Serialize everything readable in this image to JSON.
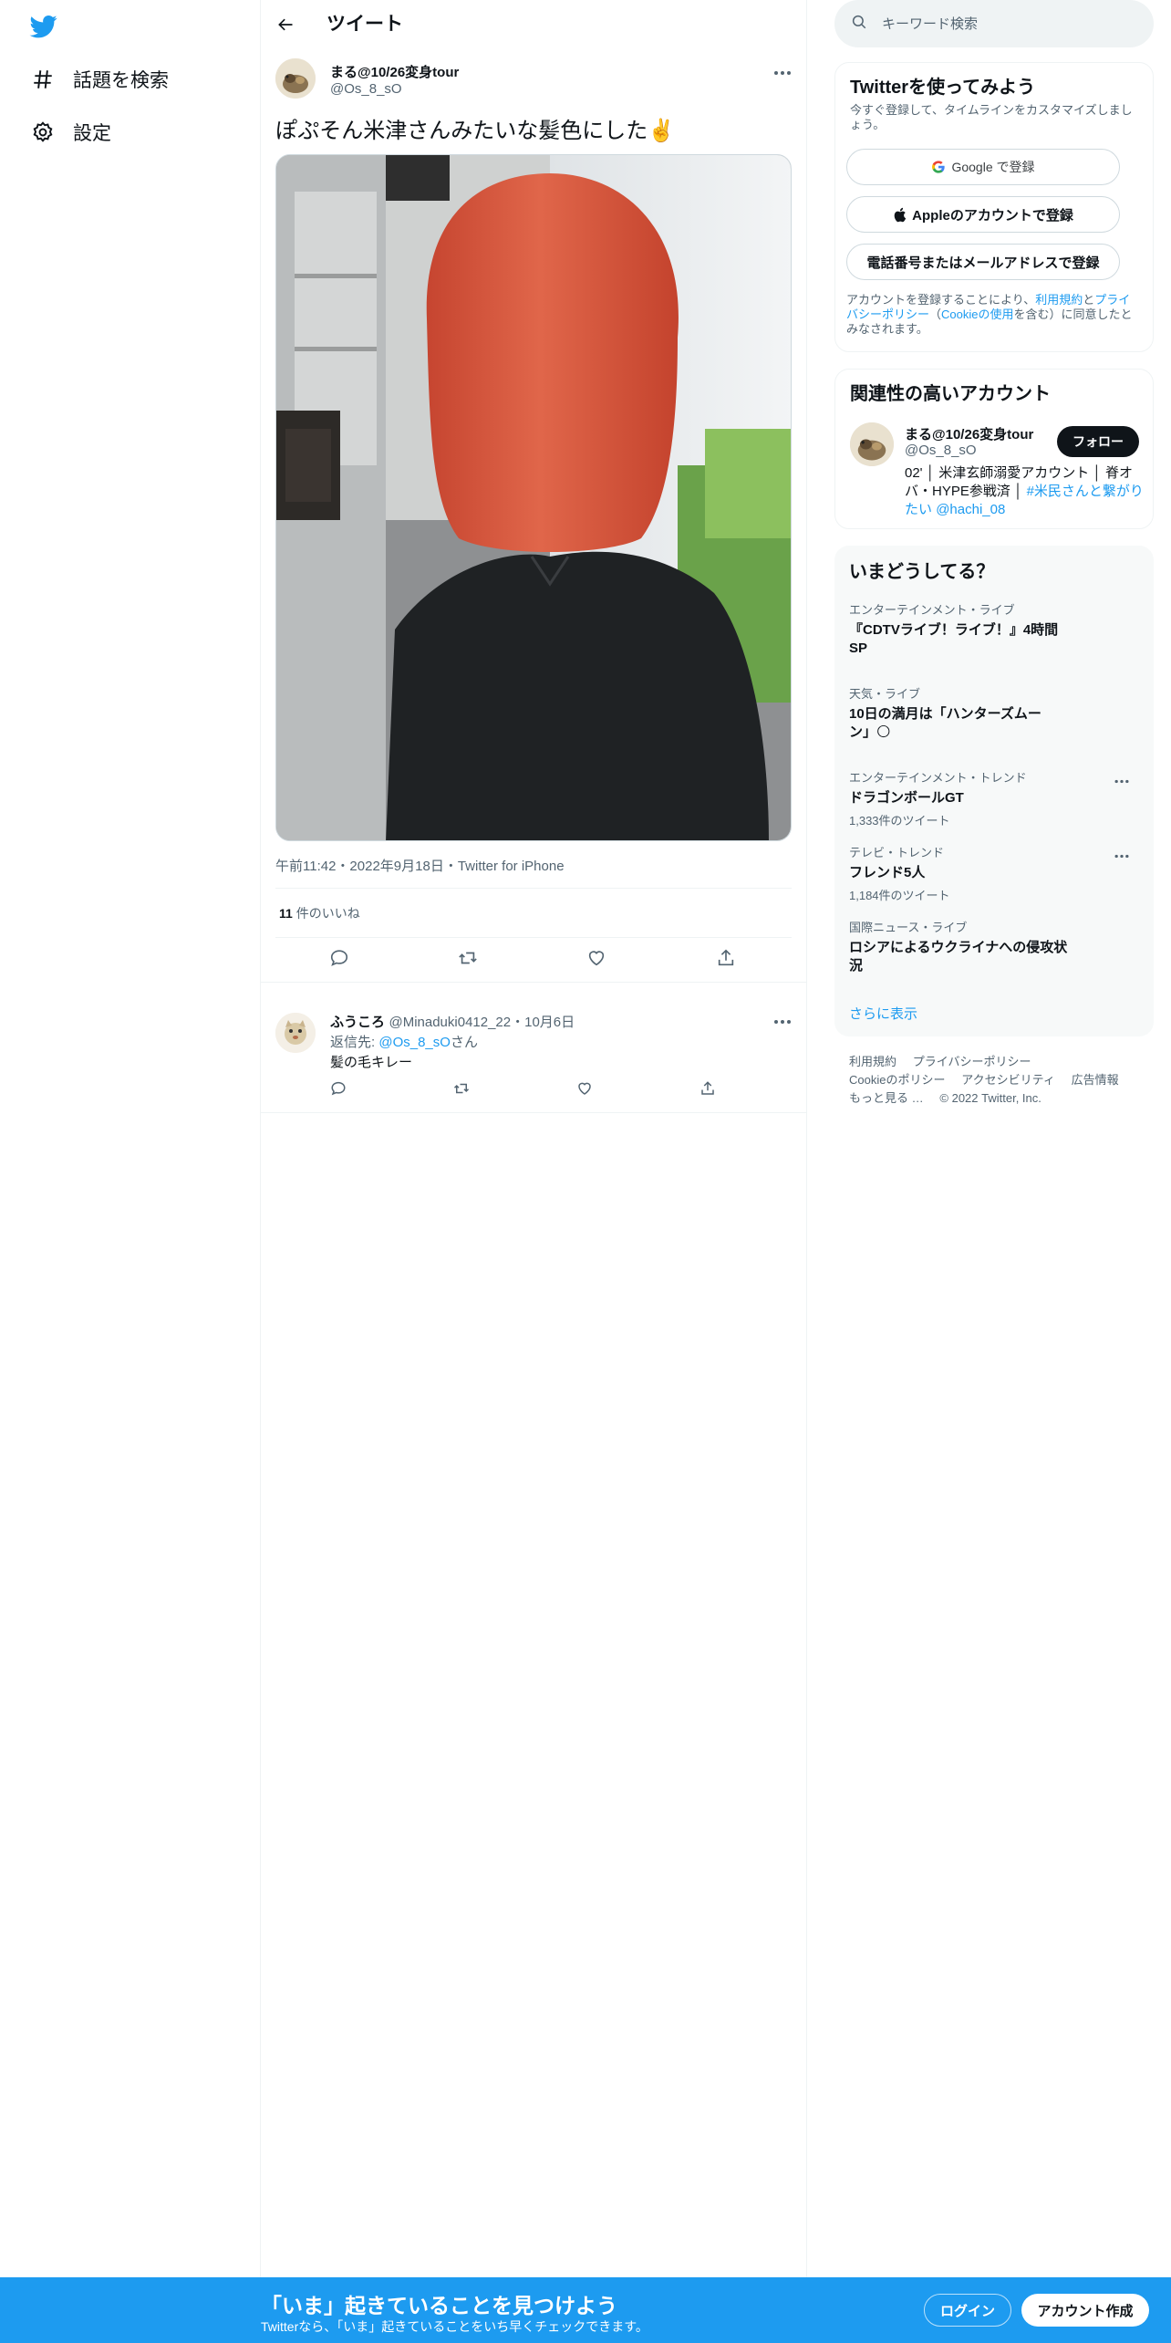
{
  "nav": {
    "items": [
      {
        "label": "話題を検索",
        "icon": "hashtag-icon"
      },
      {
        "label": "設定",
        "icon": "gear-icon"
      }
    ]
  },
  "header": {
    "title": "ツイート"
  },
  "tweet": {
    "author_name": "まる@10/26変身tour",
    "author_handle": "@Os_8_sO",
    "text": "ぽぷそん米津さんみたいな髪色にした✌️",
    "meta": "午前11:42・2022年9月18日・Twitter for iPhone",
    "likes_count": "11",
    "likes_label": " 件のいいね"
  },
  "reply": {
    "name": "ふうころ",
    "handle_date": "@Minaduki0412_22・10月6日",
    "reply_to_prefix": "返信先: ",
    "reply_to_handle": "@Os_8_sO",
    "reply_to_suffix": "さん",
    "text": "髪の毛キレー"
  },
  "search": {
    "placeholder": "キーワード検索"
  },
  "signup_card": {
    "title": "Twitterを使ってみよう",
    "subtitle": "今すぐ登録して、タイムラインをカスタマイズしましょう。",
    "google_button": "Google で登録",
    "apple_button": "Appleのアカウントで登録",
    "phone_button": "電話番号またはメールアドレスで登録",
    "legal_pre": "アカウントを登録することにより、",
    "legal_terms": "利用規約",
    "legal_and": "と",
    "legal_privacy": "プライバシーポリシー",
    "legal_paren_open": "（",
    "legal_cookie": "Cookieの使用",
    "legal_post": "を含む）に同意したとみなされます。"
  },
  "related": {
    "title": "関連性の高いアカウント",
    "name": "まる@10/26変身tour",
    "handle": "@Os_8_sO",
    "follow_label": "フォロー",
    "bio_text": "02' │ 米津玄師溺愛アカウント │ 脊オバ・HYPE参戦済 │ ",
    "bio_link1": "#米民さんと繋がりたい",
    "bio_space": " ",
    "bio_link2": "@hachi_08"
  },
  "trends": {
    "title": "いまどうしてる？",
    "items": [
      {
        "category": "エンターテインメント・ライブ",
        "title": "『CDTVライブ！ライブ！』4時間SP",
        "count": ""
      },
      {
        "category": "天気・ライブ",
        "title": "10日の満月は「ハンターズムーン」🌕",
        "count": ""
      },
      {
        "category": "エンターテインメント・トレンド",
        "title": "ドラゴンボールGT",
        "count": "1,333件のツイート"
      },
      {
        "category": "テレビ・トレンド",
        "title": "フレンド5人",
        "count": "1,184件のツイート"
      },
      {
        "category": "国際ニュース・ライブ",
        "title": "ロシアによるウクライナへの侵攻状況",
        "count": ""
      }
    ],
    "show_more": "さらに表示"
  },
  "footer": {
    "terms": "利用規約",
    "privacy": "プライバシーポリシー",
    "cookie": "Cookieのポリシー",
    "accessibility": "アクセシビリティ",
    "ads": "広告情報",
    "more": "もっと見る …",
    "copyright": "© 2022 Twitter, Inc."
  },
  "banner": {
    "title": "「いま」起きていることを見つけよう",
    "subtitle": "Twitterなら、「いま」起きていることをいち早くチェックできます。",
    "login": "ログイン",
    "signup": "アカウント作成"
  },
  "colors": {
    "accent": "#1d9bf0",
    "text": "#0f1419",
    "muted": "#536471",
    "hair": "#d9573f"
  }
}
